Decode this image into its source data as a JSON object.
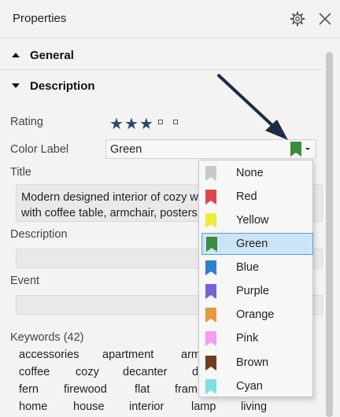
{
  "header": {
    "title": "Properties",
    "settings_icon": "gear-icon",
    "close_icon": "close-icon"
  },
  "sections": {
    "general": "General",
    "description": "Description"
  },
  "fields": {
    "rating_label": "Rating",
    "rating_value": 3,
    "rating_max": 5,
    "color_label_label": "Color Label",
    "color_label_value": "Green",
    "title_label": "Title",
    "title_line1": "Modern designed interior of cozy w",
    "title_line2": "with coffee table, armchair, posters",
    "description_label": "Description",
    "event_label": "Event"
  },
  "keywords": {
    "heading": "Keywords (42)",
    "rows": [
      [
        "accessories",
        "apartment",
        "arm"
      ],
      [
        "coffee",
        "cozy",
        "decanter",
        "d"
      ],
      [
        "fern",
        "firewood",
        "flat",
        "fram"
      ],
      [
        "home",
        "house",
        "interior",
        "lamp",
        "living"
      ]
    ]
  },
  "color_options": [
    {
      "name": "None",
      "color": "#c8c8c8"
    },
    {
      "name": "Red",
      "color": "#e0454f"
    },
    {
      "name": "Yellow",
      "color": "#ecec3a"
    },
    {
      "name": "Green",
      "color": "#3d8b3d"
    },
    {
      "name": "Blue",
      "color": "#2f7fd1"
    },
    {
      "name": "Purple",
      "color": "#7b61d9"
    },
    {
      "name": "Orange",
      "color": "#e69a3c"
    },
    {
      "name": "Pink",
      "color": "#f59cf2"
    },
    {
      "name": "Brown",
      "color": "#6e3f22"
    },
    {
      "name": "Cyan",
      "color": "#7fe0de"
    }
  ],
  "selected_color": "Green"
}
